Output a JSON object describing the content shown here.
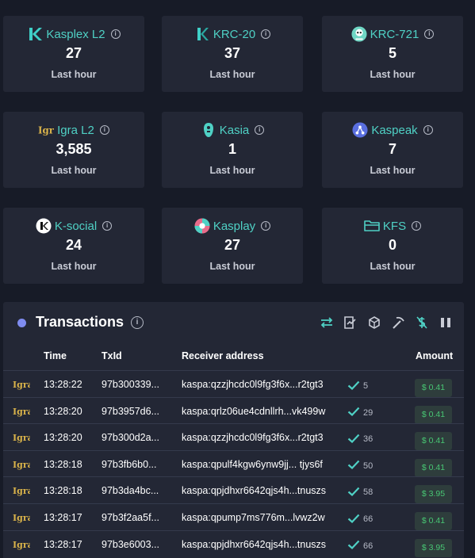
{
  "cards": [
    {
      "name": "Kasplex L2",
      "value": "27",
      "sub": "Last hour",
      "icon": "kasplex-logo-icon"
    },
    {
      "name": "KRC-20",
      "value": "37",
      "sub": "Last hour",
      "icon": "krc20-logo-icon"
    },
    {
      "name": "KRC-721",
      "value": "5",
      "sub": "Last hour",
      "icon": "krc721-logo-icon"
    },
    {
      "name": "Igra L2",
      "value": "3,585",
      "sub": "Last hour",
      "icon": "igra-logo-icon"
    },
    {
      "name": "Kasia",
      "value": "1",
      "sub": "Last hour",
      "icon": "kasia-logo-icon"
    },
    {
      "name": "Kaspeak",
      "value": "7",
      "sub": "Last hour",
      "icon": "kaspeak-logo-icon"
    },
    {
      "name": "K-social",
      "value": "24",
      "sub": "Last hour",
      "icon": "ksocial-logo-icon"
    },
    {
      "name": "Kasplay",
      "value": "27",
      "sub": "Last hour",
      "icon": "kasplay-logo-icon"
    },
    {
      "name": "KFS",
      "value": "0",
      "sub": "Last hour",
      "icon": "folder-icon"
    }
  ],
  "transactions": {
    "title": "Transactions",
    "columns": {
      "time": "Time",
      "txid": "TxId",
      "receiver": "Receiver address",
      "amount": "Amount"
    },
    "rows": [
      {
        "time": "13:28:22",
        "txid": "97b300339...",
        "receiver": "kaspa:qzzjhcdc0l9fg3f6x...r2tgt3",
        "confirmations": "5",
        "amount": "$ 0.41"
      },
      {
        "time": "13:28:20",
        "txid": "97b3957d6...",
        "receiver": "kaspa:qrlz06ue4cdnllrh...vk499w",
        "confirmations": "29",
        "amount": "$ 0.41"
      },
      {
        "time": "13:28:20",
        "txid": "97b300d2a...",
        "receiver": "kaspa:qzzjhcdc0l9fg3f6x...r2tgt3",
        "confirmations": "36",
        "amount": "$ 0.41"
      },
      {
        "time": "13:28:18",
        "txid": "97b3fb6b0...",
        "receiver": "kaspa:qpulf4kgw6ynw9jj... tjys6f",
        "confirmations": "50",
        "amount": "$ 0.41"
      },
      {
        "time": "13:28:18",
        "txid": "97b3da4bc...",
        "receiver": "kaspa:qpjdhxr6642qjs4h...tnuszs",
        "confirmations": "58",
        "amount": "$ 3.95"
      },
      {
        "time": "13:28:17",
        "txid": "97b3f2aa5f...",
        "receiver": "kaspa:qpump7ms776m...lvwz2w",
        "confirmations": "66",
        "amount": "$ 0.41"
      },
      {
        "time": "13:28:17",
        "txid": "97b3e6003...",
        "receiver": "kaspa:qpjdhxr6642qjs4h...tnuszs",
        "confirmations": "66",
        "amount": "$ 3.95"
      }
    ]
  },
  "colors": {
    "accent": "#4fd1c5",
    "amount": "#48c774",
    "dot": "#7f8cf0",
    "card": "#232735",
    "background": "#171b27"
  }
}
